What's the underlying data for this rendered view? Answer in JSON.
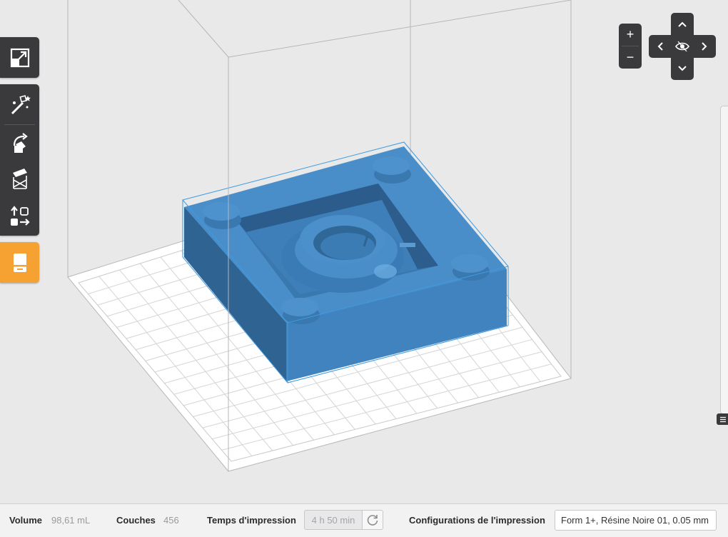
{
  "toolbar": {
    "buttons": [
      {
        "name": "scale-button",
        "icon": "resize-icon"
      },
      {
        "name": "auto-support-button",
        "icon": "magic-wand-icon"
      },
      {
        "name": "rotate-button",
        "icon": "rotate-icon"
      },
      {
        "name": "supports-button",
        "icon": "support-structure-icon"
      },
      {
        "name": "layout-button",
        "icon": "layout-arrange-icon"
      },
      {
        "name": "print-button",
        "icon": "printer-icon",
        "active_color": "#f6a233"
      }
    ]
  },
  "zoom": {
    "in_label": "+",
    "out_label": "−"
  },
  "navigation": {
    "up": "^",
    "down": "v",
    "left": "<",
    "right": ">",
    "center_icon": "eye-icon"
  },
  "model": {
    "color": "#4a8ec9",
    "selection_color": "#3d9be0"
  },
  "statusbar": {
    "volume_label": "Volume",
    "volume_value": "98,61 mL",
    "layers_label": "Couches",
    "layers_value": "456",
    "time_label": "Temps d'impression",
    "time_value": "4 h 50 min",
    "config_label": "Configurations de l'impression",
    "config_value": "Form 1+, Résine Noire 01, 0.05 mm"
  }
}
